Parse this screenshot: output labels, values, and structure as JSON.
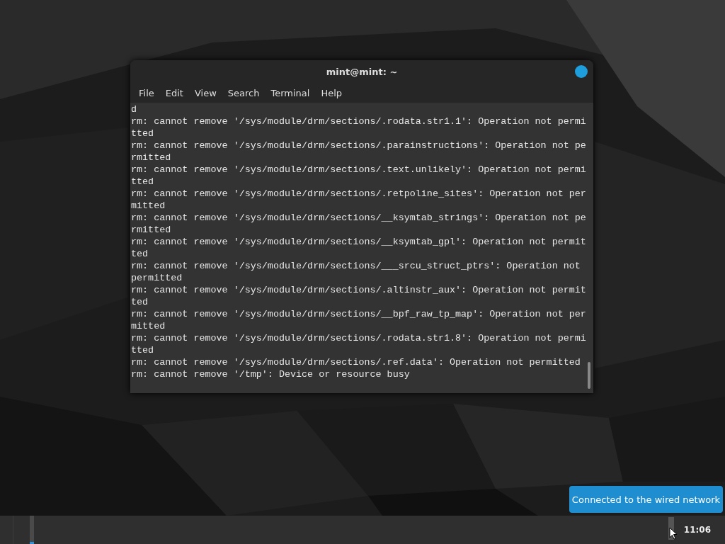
{
  "window": {
    "title": "mint@mint: ~"
  },
  "menu": [
    "File",
    "Edit",
    "View",
    "Search",
    "Terminal",
    "Help"
  ],
  "terminal_lines": [
    "d",
    "rm: cannot remove '/sys/module/drm/sections/.rodata.str1.1': Operation not permi",
    "tted",
    "rm: cannot remove '/sys/module/drm/sections/.parainstructions': Operation not pe",
    "rmitted",
    "rm: cannot remove '/sys/module/drm/sections/.text.unlikely': Operation not permi",
    "tted",
    "rm: cannot remove '/sys/module/drm/sections/.retpoline_sites': Operation not per",
    "mitted",
    "rm: cannot remove '/sys/module/drm/sections/__ksymtab_strings': Operation not pe",
    "rmitted",
    "rm: cannot remove '/sys/module/drm/sections/__ksymtab_gpl': Operation not permit",
    "ted",
    "rm: cannot remove '/sys/module/drm/sections/___srcu_struct_ptrs': Operation not",
    "permitted",
    "rm: cannot remove '/sys/module/drm/sections/.altinstr_aux': Operation not permit",
    "ted",
    "rm: cannot remove '/sys/module/drm/sections/__bpf_raw_tp_map': Operation not per",
    "mitted",
    "rm: cannot remove '/sys/module/drm/sections/.rodata.str1.8': Operation not permi",
    "tted",
    "rm: cannot remove '/sys/module/drm/sections/.ref.data': Operation not permitted",
    "rm: cannot remove '/tmp': Device or resource busy"
  ],
  "notification": {
    "text": "Connected to the wired network"
  },
  "taskbar": {
    "clock": "11:06"
  }
}
